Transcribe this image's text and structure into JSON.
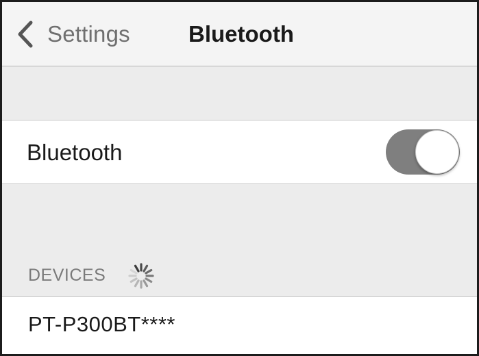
{
  "navbar": {
    "back_label": "Settings",
    "title": "Bluetooth",
    "back_icon": "chevron-left-icon"
  },
  "bluetooth": {
    "label": "Bluetooth",
    "enabled": true
  },
  "devices": {
    "header": "DEVICES",
    "status_icon": "spinner-icon",
    "items": [
      {
        "label": "PT-P300BT****"
      }
    ]
  }
}
